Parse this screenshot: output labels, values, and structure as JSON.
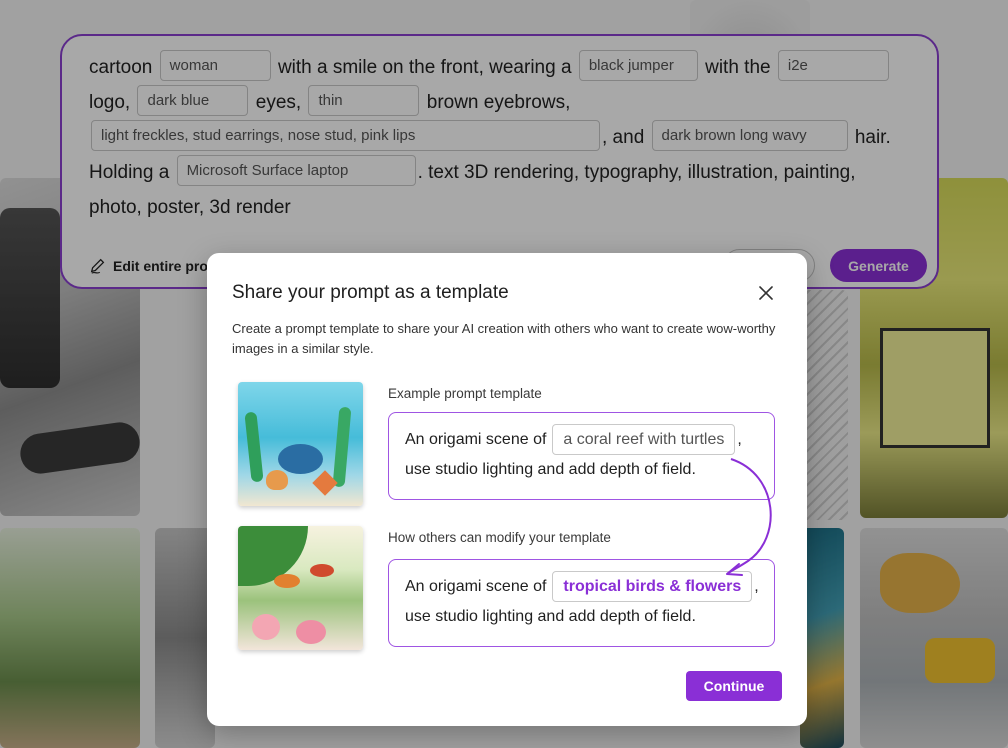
{
  "prompt": {
    "segments": {
      "s1": "cartoon",
      "p1": "woman",
      "s2": "with a smile on the front, wearing a",
      "p2": "black jumper",
      "s3": "with the",
      "p3": "i2e",
      "s4": "logo,",
      "p4": "dark blue",
      "s5": "eyes,",
      "p5": "thin",
      "s6": "brown eyebrows,",
      "p6": "light freckles, stud earrings, nose stud, pink lips",
      "s7": ", and",
      "p7": "dark brown long wavy",
      "s8": "hair.",
      "s9": "Holding a",
      "p8": "Microsoft Surface laptop",
      "s10": ". text 3D rendering, typography, illustration, painting,",
      "s11": "photo, poster, 3d render"
    },
    "edit_label": "Edit entire prompt",
    "generate_label": "Generate"
  },
  "modal": {
    "title": "Share your prompt as a template",
    "description": "Create a prompt template to share your AI creation with others who want to create wow-worthy images in a similar style.",
    "example_label": "Example prompt template",
    "example_line1_prefix": "An origami scene of",
    "example_placeholder": "a coral reef with turtles",
    "example_line1_suffix": ",",
    "example_line2": "use studio lighting and add depth of field.",
    "modify_label": "How others can modify your template",
    "modify_line1_prefix": "An origami scene of",
    "modify_value": "tropical birds & flowers",
    "modify_line1_suffix": ",",
    "modify_line2": "use studio lighting and add depth of field.",
    "continue_label": "Continue"
  },
  "colors": {
    "accent": "#8a2fd6",
    "border_accent": "#9f55e3"
  }
}
